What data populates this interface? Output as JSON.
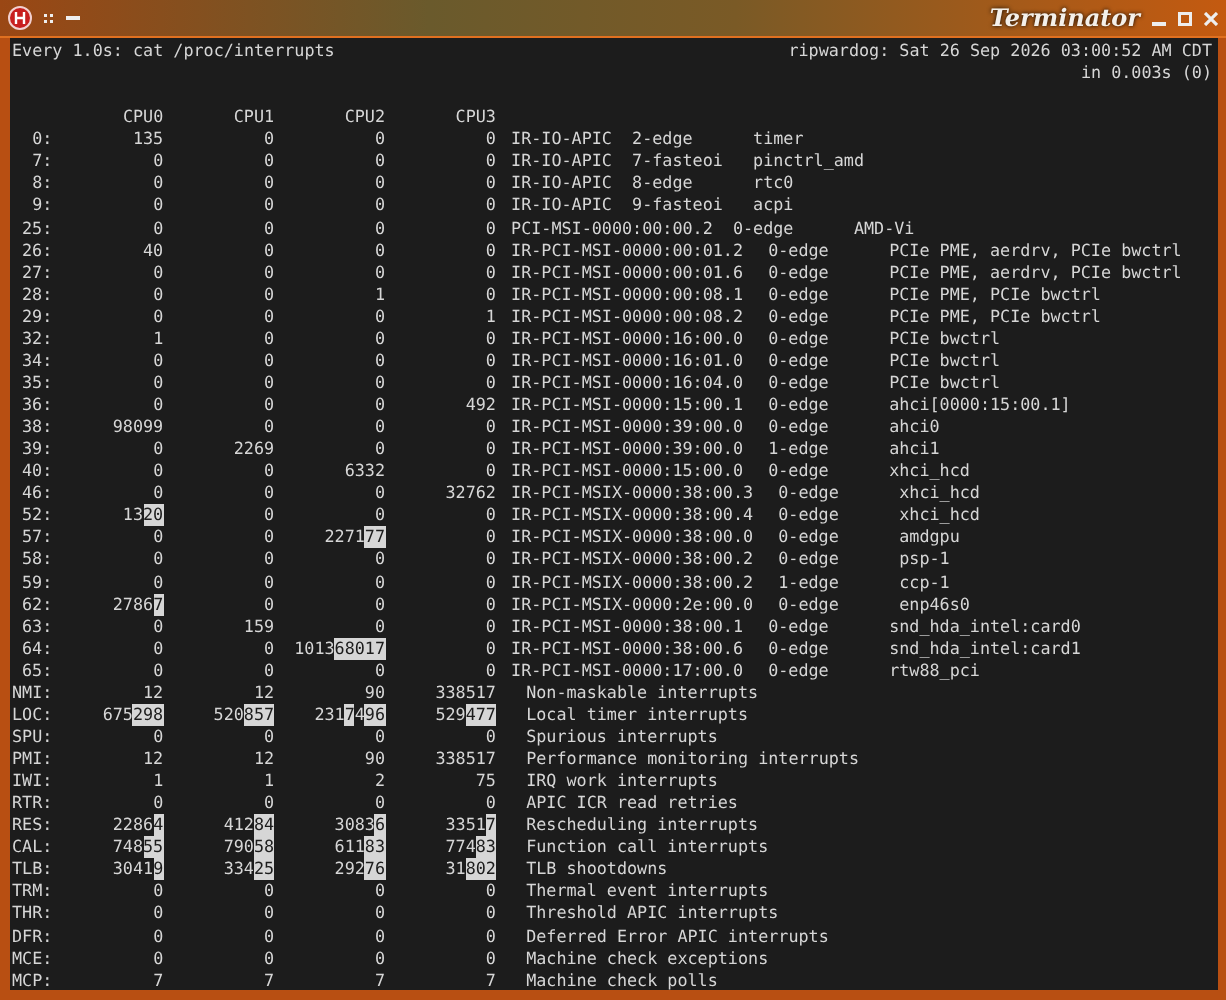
{
  "window": {
    "title": "Terminator"
  },
  "header": {
    "command": "Every 1.0s: cat /proc/interrupts",
    "host_time": "ripwardog: Sat 26 Sep 2026 03:00:52 AM CDT",
    "elapsed": "in 0.003s (0)"
  },
  "columns": [
    "CPU0",
    "CPU1",
    "CPU2",
    "CPU3"
  ],
  "irqs": [
    {
      "label": "0:",
      "counts": [
        "135",
        "0",
        "0",
        "0"
      ],
      "kind": "ioapic",
      "chip": "IR-IO-APIC",
      "hwirq": "2-edge",
      "name": "timer"
    },
    {
      "label": "7:",
      "counts": [
        "0",
        "0",
        "0",
        "0"
      ],
      "kind": "ioapic",
      "chip": "IR-IO-APIC",
      "hwirq": "7-fasteoi",
      "name": "pinctrl_amd"
    },
    {
      "label": "8:",
      "counts": [
        "0",
        "0",
        "0",
        "0"
      ],
      "kind": "ioapic",
      "chip": "IR-IO-APIC",
      "hwirq": "8-edge",
      "name": "rtc0"
    },
    {
      "label": "9:",
      "counts": [
        "0",
        "0",
        "0",
        "0"
      ],
      "kind": "ioapic",
      "chip": "IR-IO-APIC",
      "hwirq": "9-fasteoi",
      "name": "acpi"
    },
    {
      "label": "25:",
      "counts": [
        "0",
        "0",
        "0",
        "0"
      ],
      "kind": "msi",
      "chip": "PCI-MSI-0000:00:00.2",
      "hwirq": "0-edge",
      "name": "AMD-Vi"
    },
    {
      "label": "26:",
      "counts": [
        "40",
        "0",
        "0",
        "0"
      ],
      "kind": "irmsi",
      "chip": "IR-PCI-MSI-0000:00:01.2",
      "hwirq": "0-edge",
      "name": "PCIe PME, aerdrv, PCIe bwctrl"
    },
    {
      "label": "27:",
      "counts": [
        "0",
        "0",
        "0",
        "0"
      ],
      "kind": "irmsi",
      "chip": "IR-PCI-MSI-0000:00:01.6",
      "hwirq": "0-edge",
      "name": "PCIe PME, aerdrv, PCIe bwctrl"
    },
    {
      "label": "28:",
      "counts": [
        "0",
        "0",
        "1",
        "0"
      ],
      "kind": "irmsi",
      "chip": "IR-PCI-MSI-0000:00:08.1",
      "hwirq": "0-edge",
      "name": "PCIe PME, PCIe bwctrl"
    },
    {
      "label": "29:",
      "counts": [
        "0",
        "0",
        "0",
        "1"
      ],
      "kind": "irmsi",
      "chip": "IR-PCI-MSI-0000:00:08.2",
      "hwirq": "0-edge",
      "name": "PCIe PME, PCIe bwctrl"
    },
    {
      "label": "32:",
      "counts": [
        "1",
        "0",
        "0",
        "0"
      ],
      "kind": "irmsi",
      "chip": "IR-PCI-MSI-0000:16:00.0",
      "hwirq": "0-edge",
      "name": "PCIe bwctrl"
    },
    {
      "label": "34:",
      "counts": [
        "0",
        "0",
        "0",
        "0"
      ],
      "kind": "irmsi",
      "chip": "IR-PCI-MSI-0000:16:01.0",
      "hwirq": "0-edge",
      "name": "PCIe bwctrl"
    },
    {
      "label": "35:",
      "counts": [
        "0",
        "0",
        "0",
        "0"
      ],
      "kind": "irmsi",
      "chip": "IR-PCI-MSI-0000:16:04.0",
      "hwirq": "0-edge",
      "name": "PCIe bwctrl"
    },
    {
      "label": "36:",
      "counts": [
        "0",
        "0",
        "0",
        "492"
      ],
      "kind": "irmsi",
      "chip": "IR-PCI-MSI-0000:15:00.1",
      "hwirq": "0-edge",
      "name": "ahci[0000:15:00.1]"
    },
    {
      "label": "38:",
      "counts": [
        "98099",
        "0",
        "0",
        "0"
      ],
      "kind": "irmsi",
      "chip": "IR-PCI-MSI-0000:39:00.0",
      "hwirq": "0-edge",
      "name": "ahci0"
    },
    {
      "label": "39:",
      "counts": [
        "0",
        "2269",
        "0",
        "0"
      ],
      "kind": "irmsi",
      "chip": "IR-PCI-MSI-0000:39:00.0",
      "hwirq": "1-edge",
      "name": "ahci1"
    },
    {
      "label": "40:",
      "counts": [
        "0",
        "0",
        "6332",
        "0"
      ],
      "kind": "irmsi",
      "chip": "IR-PCI-MSI-0000:15:00.0",
      "hwirq": "0-edge",
      "name": "xhci_hcd"
    },
    {
      "label": "46:",
      "counts": [
        "0",
        "0",
        "0",
        "32762"
      ],
      "kind": "msix",
      "chip": "IR-PCI-MSIX-0000:38:00.3",
      "hwirq": "0-edge",
      "name": "xhci_hcd"
    },
    {
      "label": "52:",
      "counts": [
        {
          "parts": [
            {
              "text": "13",
              "changed": false
            },
            {
              "text": "20",
              "changed": true
            }
          ]
        },
        "0",
        "0",
        "0"
      ],
      "kind": "msix",
      "chip": "IR-PCI-MSIX-0000:38:00.4",
      "hwirq": "0-edge",
      "name": "xhci_hcd"
    },
    {
      "label": "57:",
      "counts": [
        "0",
        "0",
        {
          "parts": [
            {
              "text": "2271",
              "changed": false
            },
            {
              "text": "77",
              "changed": true
            }
          ]
        },
        "0"
      ],
      "kind": "msix",
      "chip": "IR-PCI-MSIX-0000:38:00.0",
      "hwirq": "0-edge",
      "name": "amdgpu"
    },
    {
      "label": "58:",
      "counts": [
        "0",
        "0",
        "0",
        "0"
      ],
      "kind": "msix",
      "chip": "IR-PCI-MSIX-0000:38:00.2",
      "hwirq": "0-edge",
      "name": "psp-1"
    },
    {
      "label": "59:",
      "counts": [
        "0",
        "0",
        "0",
        "0"
      ],
      "kind": "msix",
      "chip": "IR-PCI-MSIX-0000:38:00.2",
      "hwirq": "1-edge",
      "name": "ccp-1"
    },
    {
      "label": "62:",
      "counts": [
        {
          "parts": [
            {
              "text": "2786",
              "changed": false
            },
            {
              "text": "7",
              "changed": true
            }
          ]
        },
        "0",
        "0",
        "0"
      ],
      "kind": "msix",
      "chip": "IR-PCI-MSIX-0000:2e:00.0",
      "hwirq": "0-edge",
      "name": "enp46s0"
    },
    {
      "label": "63:",
      "counts": [
        "0",
        "159",
        "0",
        "0"
      ],
      "kind": "irmsi",
      "chip": "IR-PCI-MSI-0000:38:00.1",
      "hwirq": "0-edge",
      "name": "snd_hda_intel:card0"
    },
    {
      "label": "64:",
      "counts": [
        "0",
        "0",
        {
          "parts": [
            {
              "text": "1013",
              "changed": false
            },
            {
              "text": "68017",
              "changed": true
            }
          ]
        },
        "0"
      ],
      "kind": "irmsi",
      "chip": "IR-PCI-MSI-0000:38:00.6",
      "hwirq": "0-edge",
      "name": "snd_hda_intel:card1"
    },
    {
      "label": "65:",
      "counts": [
        "0",
        "0",
        "0",
        "0"
      ],
      "kind": "irmsi",
      "chip": "IR-PCI-MSI-0000:17:00.0",
      "hwirq": "0-edge",
      "name": "rtw88_pci"
    }
  ],
  "system": [
    {
      "label": "NMI:",
      "counts": [
        "12",
        "12",
        "90",
        "338517"
      ],
      "description": "Non-maskable interrupts"
    },
    {
      "label": "LOC:",
      "counts": [
        {
          "parts": [
            {
              "text": "675",
              "changed": false
            },
            {
              "text": "298",
              "changed": true
            }
          ]
        },
        {
          "parts": [
            {
              "text": "520",
              "changed": false
            },
            {
              "text": "857",
              "changed": true
            }
          ]
        },
        {
          "parts": [
            {
              "text": "231",
              "changed": false
            },
            {
              "text": "7",
              "changed": true
            },
            {
              "text": "4",
              "changed": false
            },
            {
              "text": "96",
              "changed": true
            }
          ]
        },
        {
          "parts": [
            {
              "text": "529",
              "changed": false
            },
            {
              "text": "477",
              "changed": true
            }
          ]
        }
      ],
      "description": "Local timer interrupts"
    },
    {
      "label": "SPU:",
      "counts": [
        "0",
        "0",
        "0",
        "0"
      ],
      "description": "Spurious interrupts"
    },
    {
      "label": "PMI:",
      "counts": [
        "12",
        "12",
        "90",
        "338517"
      ],
      "description": "Performance monitoring interrupts"
    },
    {
      "label": "IWI:",
      "counts": [
        "1",
        "1",
        "2",
        "75"
      ],
      "description": "IRQ work interrupts"
    },
    {
      "label": "RTR:",
      "counts": [
        "0",
        "0",
        "0",
        "0"
      ],
      "description": "APIC ICR read retries"
    },
    {
      "label": "RES:",
      "counts": [
        {
          "parts": [
            {
              "text": "2286",
              "changed": false
            },
            {
              "text": "4",
              "changed": true
            }
          ]
        },
        {
          "parts": [
            {
              "text": "412",
              "changed": false
            },
            {
              "text": "84",
              "changed": true
            }
          ]
        },
        {
          "parts": [
            {
              "text": "3083",
              "changed": false
            },
            {
              "text": "6",
              "changed": true
            }
          ]
        },
        {
          "parts": [
            {
              "text": "3351",
              "changed": false
            },
            {
              "text": "7",
              "changed": true
            }
          ]
        }
      ],
      "description": "Rescheduling interrupts"
    },
    {
      "label": "CAL:",
      "counts": [
        {
          "parts": [
            {
              "text": "748",
              "changed": false
            },
            {
              "text": "55",
              "changed": true
            }
          ]
        },
        {
          "parts": [
            {
              "text": "790",
              "changed": false
            },
            {
              "text": "58",
              "changed": true
            }
          ]
        },
        {
          "parts": [
            {
              "text": "611",
              "changed": false
            },
            {
              "text": "83",
              "changed": true
            }
          ]
        },
        {
          "parts": [
            {
              "text": "774",
              "changed": false
            },
            {
              "text": "83",
              "changed": true
            }
          ]
        }
      ],
      "description": "Function call interrupts"
    },
    {
      "label": "TLB:",
      "counts": [
        {
          "parts": [
            {
              "text": "3041",
              "changed": false
            },
            {
              "text": "9",
              "changed": true
            }
          ]
        },
        {
          "parts": [
            {
              "text": "334",
              "changed": false
            },
            {
              "text": "25",
              "changed": true
            }
          ]
        },
        {
          "parts": [
            {
              "text": "292",
              "changed": false
            },
            {
              "text": "76",
              "changed": true
            }
          ]
        },
        {
          "parts": [
            {
              "text": "31",
              "changed": false
            },
            {
              "text": "802",
              "changed": true
            }
          ]
        }
      ],
      "description": "TLB shootdowns"
    },
    {
      "label": "TRM:",
      "counts": [
        "0",
        "0",
        "0",
        "0"
      ],
      "description": "Thermal event interrupts"
    },
    {
      "label": "THR:",
      "counts": [
        "0",
        "0",
        "0",
        "0"
      ],
      "description": "Threshold APIC interrupts"
    },
    {
      "label": "DFR:",
      "counts": [
        "0",
        "0",
        "0",
        "0"
      ],
      "description": "Deferred Error APIC interrupts"
    },
    {
      "label": "MCE:",
      "counts": [
        "0",
        "0",
        "0",
        "0"
      ],
      "description": "Machine check exceptions"
    },
    {
      "label": "MCP:",
      "counts": [
        "7",
        "7",
        "7",
        "7"
      ],
      "description": "Machine check polls"
    }
  ]
}
